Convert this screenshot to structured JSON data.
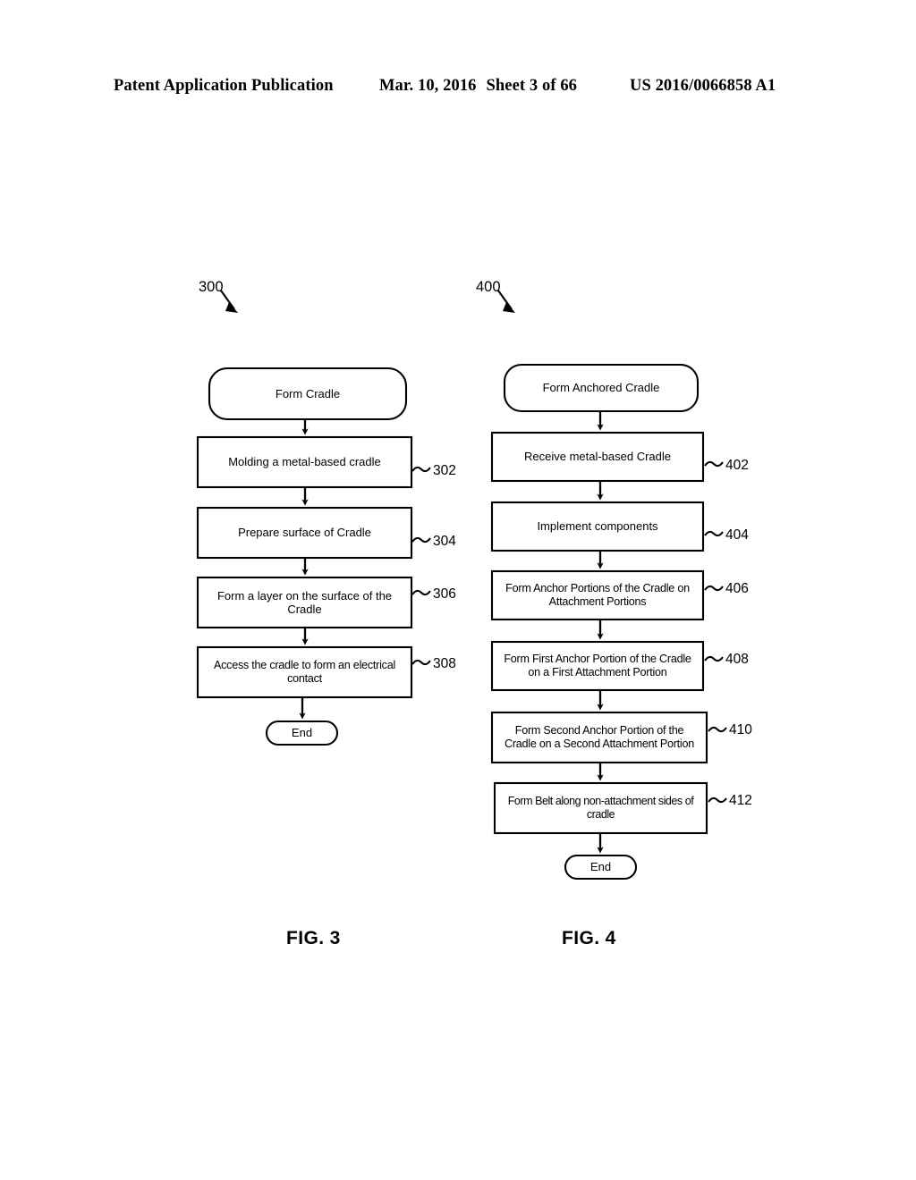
{
  "header": {
    "publication": "Patent Application Publication",
    "date": "Mar. 10, 2016",
    "sheet": "Sheet 3 of 66",
    "patent_number": "US 2016/0066858 A1"
  },
  "colors": {
    "ink": "#000000",
    "paper": "#ffffff"
  },
  "figures": [
    {
      "id": "fig3",
      "caption": "FIG. 3",
      "flow_label": "300",
      "nodes": [
        {
          "id": "start",
          "shape": "rounded",
          "label": "Form Cradle",
          "ref": null
        },
        {
          "id": "s302",
          "shape": "rect",
          "label": "Molding a metal-based cradle",
          "ref": "302"
        },
        {
          "id": "s304",
          "shape": "rect",
          "label": "Prepare surface of Cradle",
          "ref": "304"
        },
        {
          "id": "s306",
          "shape": "rect",
          "label": "Form a layer on the surface of the\nCradle",
          "ref": "306"
        },
        {
          "id": "s308",
          "shape": "rect",
          "label": "Access the cradle to form an electrical\ncontact",
          "ref": "308"
        },
        {
          "id": "end",
          "shape": "pill",
          "label": "End",
          "ref": null
        }
      ]
    },
    {
      "id": "fig4",
      "caption": "FIG. 4",
      "flow_label": "400",
      "nodes": [
        {
          "id": "start",
          "shape": "rounded",
          "label": "Form Anchored Cradle",
          "ref": null
        },
        {
          "id": "s402",
          "shape": "rect",
          "label": "Receive metal-based Cradle",
          "ref": "402"
        },
        {
          "id": "s404",
          "shape": "rect",
          "label": "Implement components",
          "ref": "404"
        },
        {
          "id": "s406",
          "shape": "rect",
          "label": "Form Anchor Portions of the Cradle on\nAttachment Portions",
          "ref": "406"
        },
        {
          "id": "s408",
          "shape": "rect",
          "label": "Form First Anchor Portion of the Cradle\non a First Attachment Portion",
          "ref": "408"
        },
        {
          "id": "s410",
          "shape": "rect",
          "label": "Form Second Anchor Portion of the\nCradle on a Second Attachment Portion",
          "ref": "410"
        },
        {
          "id": "s412",
          "shape": "rect",
          "label": "Form Belt along non-attachment sides of\ncradle",
          "ref": "412"
        },
        {
          "id": "end",
          "shape": "pill",
          "label": "End",
          "ref": null
        }
      ]
    }
  ]
}
